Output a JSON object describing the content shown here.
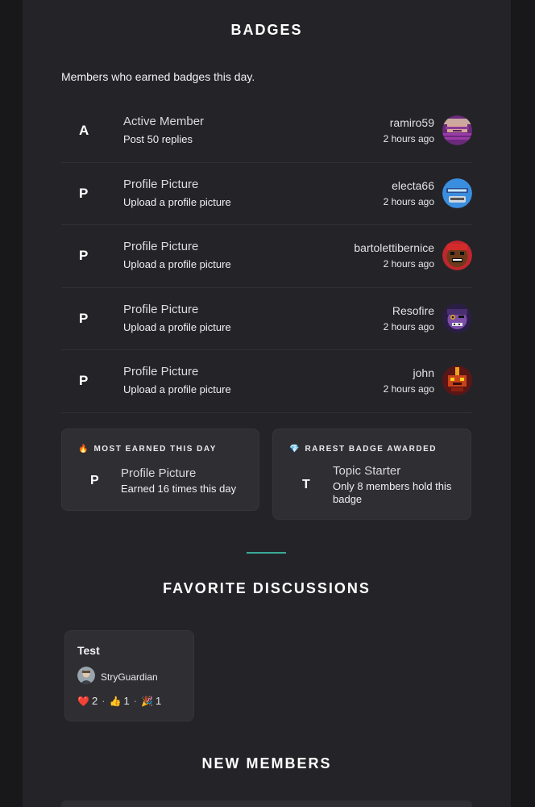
{
  "badges": {
    "title": "BADGES",
    "intro": "Members who earned badges this day.",
    "rows": [
      {
        "letter": "A",
        "name": "Active Member",
        "desc": "Post 50 replies",
        "user": "ramiro59",
        "time": "2 hours ago"
      },
      {
        "letter": "P",
        "name": "Profile Picture",
        "desc": "Upload a profile picture",
        "user": "electa66",
        "time": "2 hours ago"
      },
      {
        "letter": "P",
        "name": "Profile Picture",
        "desc": "Upload a profile picture",
        "user": "bartolettibernice",
        "time": "2 hours ago"
      },
      {
        "letter": "P",
        "name": "Profile Picture",
        "desc": "Upload a profile picture",
        "user": "Resofire",
        "time": "2 hours ago"
      },
      {
        "letter": "P",
        "name": "Profile Picture",
        "desc": "Upload a profile picture",
        "user": "john",
        "time": "2 hours ago"
      }
    ]
  },
  "most_earned": {
    "icon": "fire-icon",
    "heading": "MOST EARNED THIS DAY",
    "letter": "P",
    "name": "Profile Picture",
    "desc": "Earned 16 times this day"
  },
  "rarest": {
    "icon": "gem-icon",
    "heading": "RAREST BADGE AWARDED",
    "letter": "T",
    "name": "Topic Starter",
    "desc": "Only 8 members hold this badge"
  },
  "favorites": {
    "title": "FAVORITE DISCUSSIONS",
    "card": {
      "title": "Test",
      "author": "StryGuardian",
      "reactions": [
        {
          "icon": "heart-emoji",
          "count": "2"
        },
        {
          "icon": "thumbs-up-emoji",
          "count": "1"
        },
        {
          "icon": "party-popper-emoji",
          "count": "1"
        }
      ]
    }
  },
  "new_members": {
    "title": "NEW MEMBERS"
  },
  "colors": {
    "page_bg": "#18181b",
    "panel_bg": "#242428",
    "card_bg": "#2e2e33",
    "accent": "#3aa897"
  }
}
